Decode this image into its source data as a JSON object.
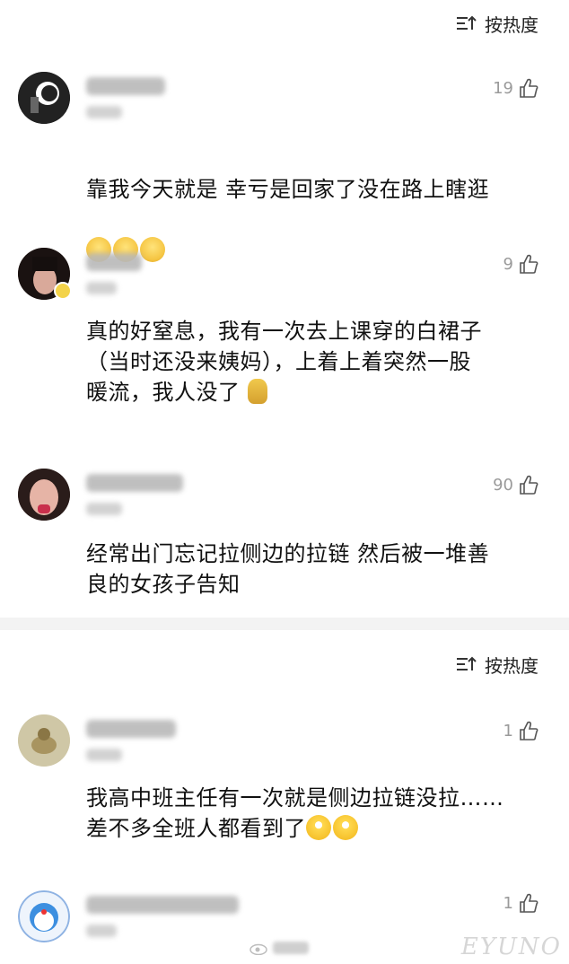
{
  "sort_label": "按热度",
  "sort_label_2": "按热度",
  "comments": [
    {
      "likes": "19",
      "text": "靠我今天就是 幸亏是回家了没在路上瞎逛",
      "emojis": [
        "cry-emoji",
        "cry-emoji",
        "cry-emoji"
      ]
    },
    {
      "likes": "9",
      "text": "真的好窒息，我有一次去上课穿的白裙子\n（当时还没来姨妈），上着上着突然一股\n暖流，我人没了",
      "emojis": [
        "facepalm-emoji"
      ]
    },
    {
      "likes": "90",
      "text": "经常出门忘记拉侧边的拉链 然后被一堆善\n良的女孩子告知",
      "emojis": []
    },
    {
      "likes": "1",
      "text": "我高中班主任有一次就是侧边拉链没拉……\n差不多全班人都看到了",
      "emojis": [
        "laugh-cry-emoji",
        "laugh-cry-emoji"
      ]
    },
    {
      "likes": "1",
      "text": "",
      "emojis": []
    }
  ],
  "watermark": "EYUNO",
  "colors": {
    "text": "#111111",
    "muted": "#9a9a9a",
    "divider": "#f3f3f3"
  }
}
